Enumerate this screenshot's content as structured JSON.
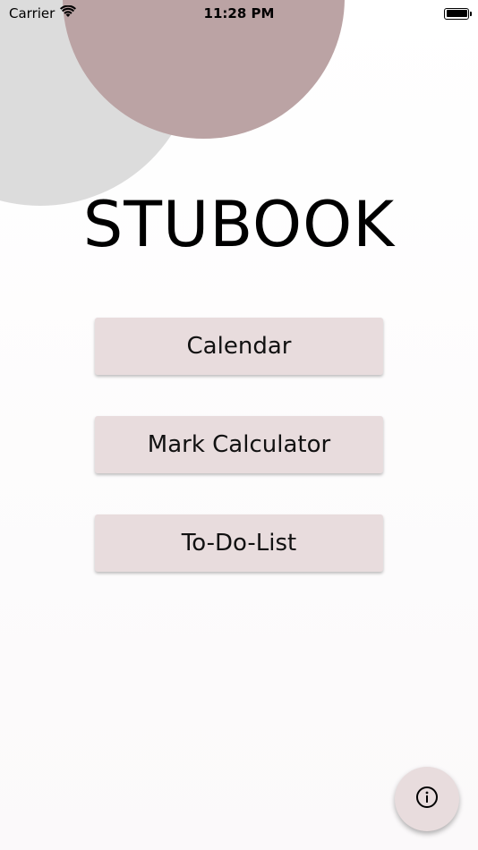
{
  "status_bar": {
    "carrier": "Carrier",
    "time": "11:28 PM",
    "wifi_icon": "wifi-icon",
    "battery_icon": "battery-icon"
  },
  "app": {
    "title": "STUBOOK"
  },
  "menu": {
    "calendar_label": "Calendar",
    "mark_calculator_label": "Mark Calculator",
    "todo_label": "To-Do-List"
  },
  "fab": {
    "icon": "info-icon"
  },
  "colors": {
    "button_bg": "#e8dcdd",
    "circle_rose": "#bba3a4",
    "circle_grey": "#dcdcdc"
  }
}
